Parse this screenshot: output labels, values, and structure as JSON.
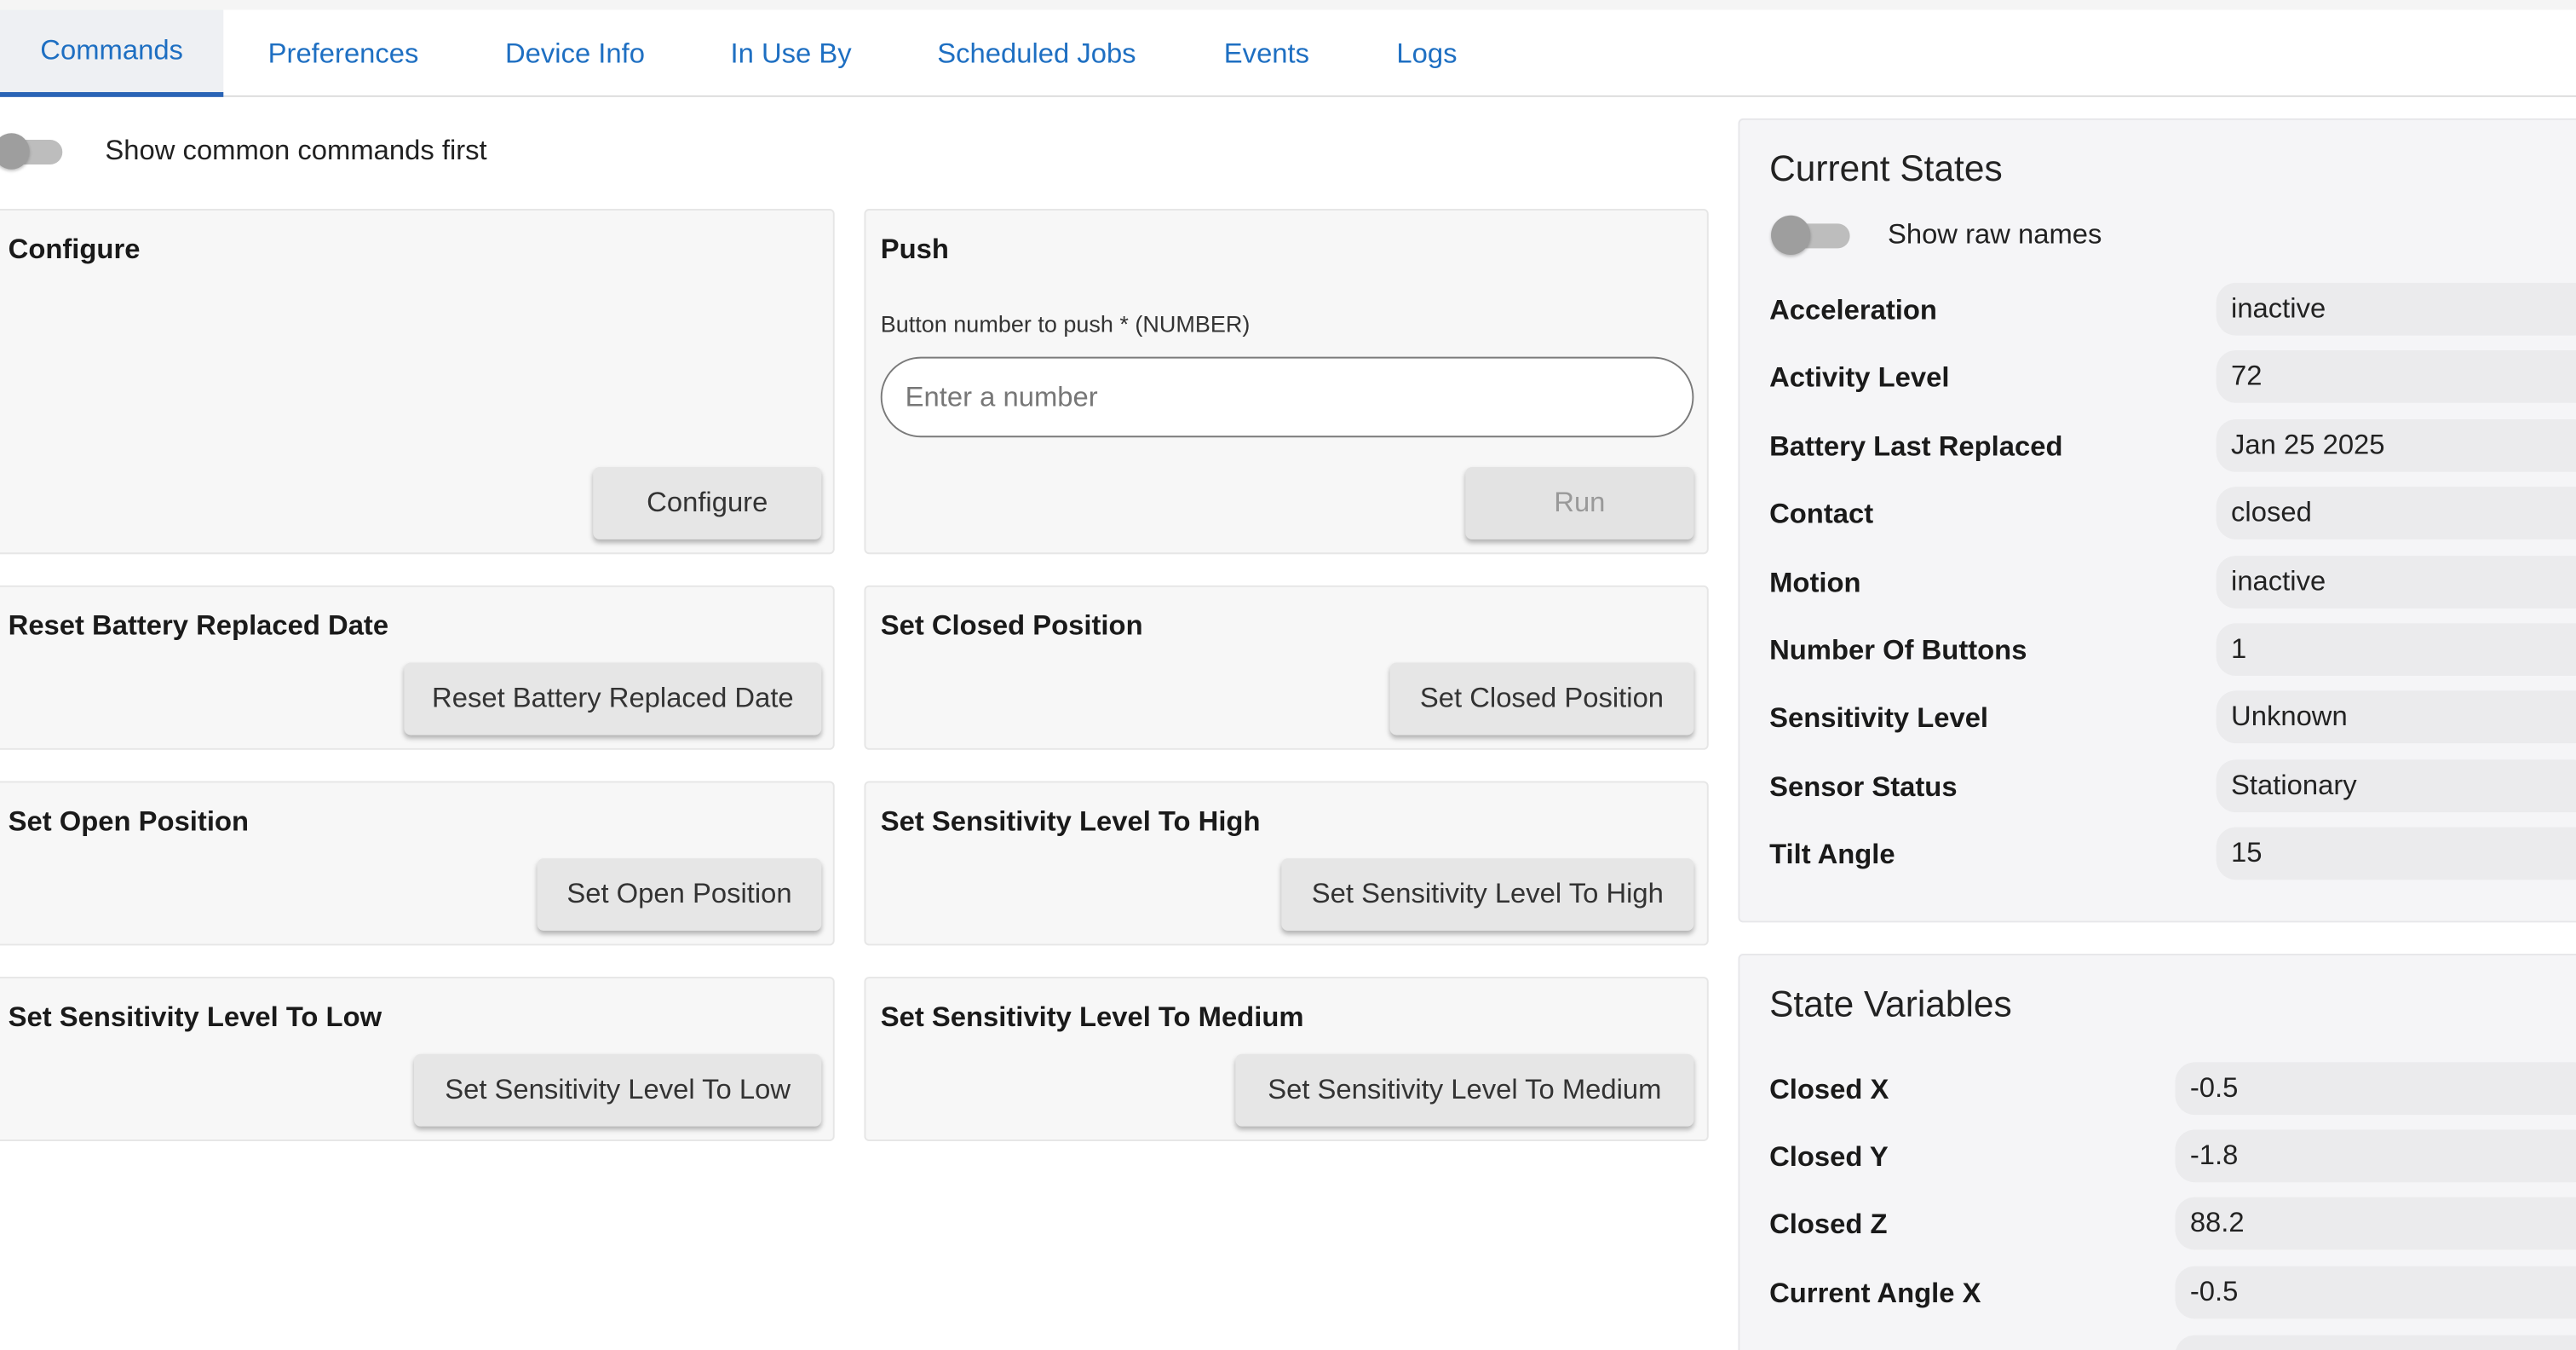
{
  "tabs": [
    {
      "label": "Commands",
      "active": true
    },
    {
      "label": "Preferences"
    },
    {
      "label": "Device Info"
    },
    {
      "label": "In Use By"
    },
    {
      "label": "Scheduled Jobs"
    },
    {
      "label": "Events"
    },
    {
      "label": "Logs"
    }
  ],
  "commands": {
    "common_first_label": "Show common commands first",
    "configure": {
      "title": "Configure",
      "button": "Configure"
    },
    "push": {
      "title": "Push",
      "field_label": "Button number to push * (NUMBER)",
      "placeholder": "Enter a number",
      "value": "",
      "button": "Run"
    },
    "reset_battery": {
      "title": "Reset Battery Replaced Date",
      "button": "Reset Battery Replaced Date"
    },
    "set_closed": {
      "title": "Set Closed Position",
      "button": "Set Closed Position"
    },
    "set_open": {
      "title": "Set Open Position",
      "button": "Set Open Position"
    },
    "sens_high": {
      "title": "Set Sensitivity Level To High",
      "button": "Set Sensitivity Level To High"
    },
    "sens_low": {
      "title": "Set Sensitivity Level To Low",
      "button": "Set Sensitivity Level To Low"
    },
    "sens_medium": {
      "title": "Set Sensitivity Level To Medium",
      "button": "Set Sensitivity Level To Medium"
    }
  },
  "current_states": {
    "title": "Current States",
    "raw_names_label": "Show raw names",
    "items": [
      {
        "label": "Acceleration",
        "value": "inactive"
      },
      {
        "label": "Activity Level",
        "value": "72"
      },
      {
        "label": "Battery Last Replaced",
        "value": "Jan 25 2025"
      },
      {
        "label": "Contact",
        "value": "closed"
      },
      {
        "label": "Motion",
        "value": "inactive"
      },
      {
        "label": "Number Of Buttons",
        "value": "1"
      },
      {
        "label": "Sensitivity Level",
        "value": "Unknown"
      },
      {
        "label": "Sensor Status",
        "value": "Stationary"
      },
      {
        "label": "Tilt Angle",
        "value": "15"
      }
    ]
  },
  "state_variables": {
    "title": "State Variables",
    "items": [
      {
        "label": "Closed X",
        "value": "-0.5"
      },
      {
        "label": "Closed Y",
        "value": "-1.8"
      },
      {
        "label": "Closed Z",
        "value": "88.2"
      },
      {
        "label": "Current Angle X",
        "value": "-0.5"
      }
    ]
  },
  "colors": {
    "tab_text": "#1e6fc2",
    "tab_active_bar": "#2a64b6",
    "card_bg": "#f7f7f7",
    "button_bg": "#e6e6e6"
  }
}
